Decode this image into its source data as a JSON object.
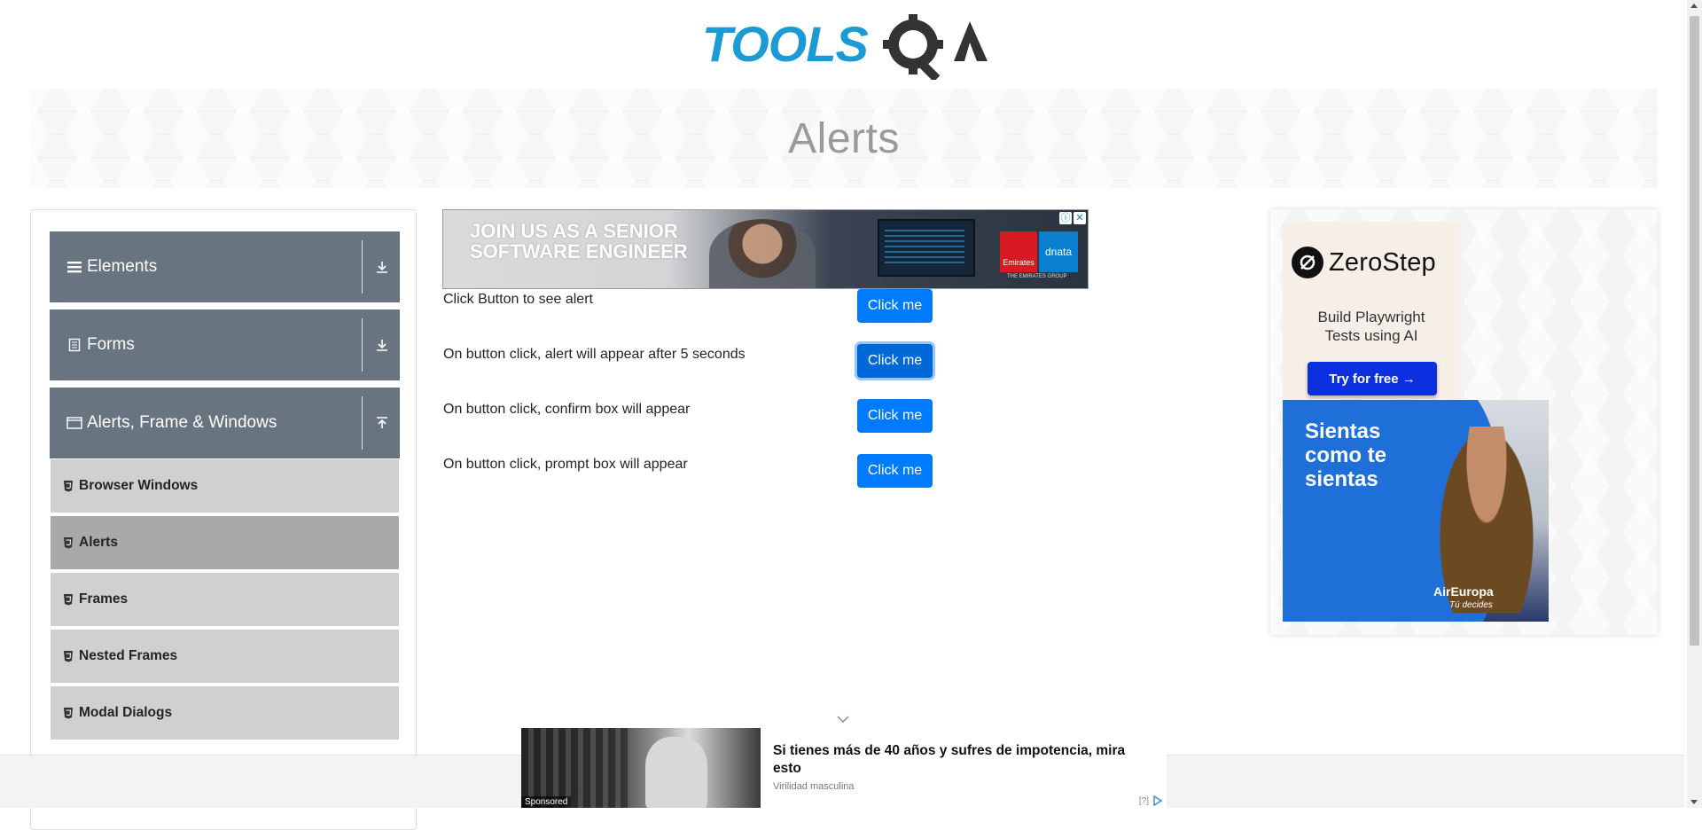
{
  "header": {
    "logo_text": "TOOLSQA",
    "page_title": "Alerts"
  },
  "sidebar": {
    "groups": [
      {
        "label": "Elements",
        "icon": "hamburger-icon",
        "expanded": false
      },
      {
        "label": "Forms",
        "icon": "document-icon",
        "expanded": false
      },
      {
        "label": "Alerts, Frame & Windows",
        "icon": "window-icon",
        "expanded": true
      }
    ],
    "items": [
      {
        "label": "Browser Windows",
        "active": false
      },
      {
        "label": "Alerts",
        "active": true
      },
      {
        "label": "Frames",
        "active": false
      },
      {
        "label": "Nested Frames",
        "active": false
      },
      {
        "label": "Modal Dialogs",
        "active": false
      }
    ]
  },
  "main": {
    "top_ad": {
      "headline": "JOIN US AS A SENIOR SOFTWARE ENGINEER",
      "brand_1": "Emirates",
      "brand_2": "dnata",
      "sub": "THE EMIRATES GROUP"
    },
    "rows": [
      {
        "text": "Click Button to see alert",
        "button": "Click me"
      },
      {
        "text": "On button click, alert will appear after 5 seconds",
        "button": "Click me"
      },
      {
        "text": "On button click, confirm box will appear",
        "button": "Click me"
      },
      {
        "text": "On button click, prompt box will appear",
        "button": "Click me"
      }
    ]
  },
  "right_ad": {
    "zerostep": {
      "name": "ZeroStep",
      "tagline": "Build Playwright Tests using AI",
      "cta": "Try for free →"
    },
    "aireuropa": {
      "headline": "Sientas como te sientas",
      "brand": "AirEuropa",
      "slogan": "Tú decides"
    }
  },
  "bottom_ad": {
    "label": "Sponsored",
    "title": "Si tienes más de 40 años y sufres de impotencia, mira esto",
    "source": "Virilidad masculina",
    "info": "[?]"
  },
  "colors": {
    "accent_blue": "#007bff",
    "sidebar_header": "#687480",
    "sidebar_item": "#d0d0d0",
    "sidebar_item_active": "#a9a9a9",
    "logo_blue": "#1c9ad6",
    "logo_dark": "#333333"
  }
}
